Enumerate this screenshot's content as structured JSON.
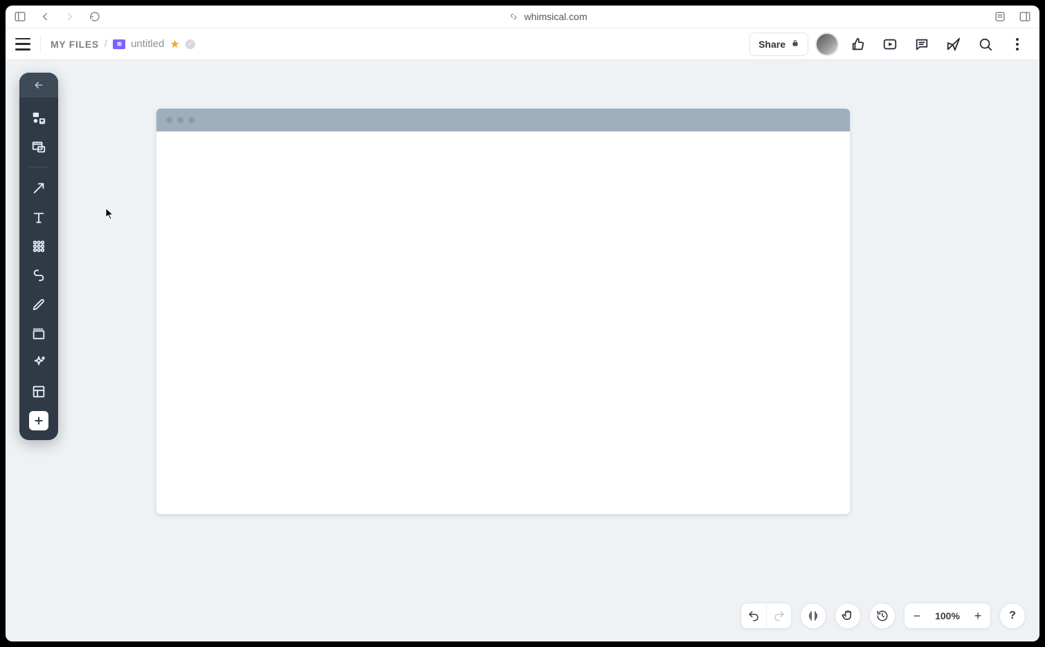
{
  "browser": {
    "url": "whimsical.com"
  },
  "header": {
    "breadcrumb_root": "MY FILES",
    "breadcrumb_separator": "/",
    "file_title": "untitled",
    "share_label": "Share"
  },
  "toolbar": {
    "items": [
      {
        "name": "elements-tool"
      },
      {
        "name": "frame-tool"
      },
      {
        "name": "arrow-tool"
      },
      {
        "name": "text-tool"
      },
      {
        "name": "grid-tool"
      },
      {
        "name": "link-tool"
      },
      {
        "name": "pencil-tool"
      },
      {
        "name": "section-tool"
      },
      {
        "name": "ai-tool"
      },
      {
        "name": "layout-tool"
      }
    ]
  },
  "bottom": {
    "zoom_value": "100%",
    "help_label": "?"
  }
}
